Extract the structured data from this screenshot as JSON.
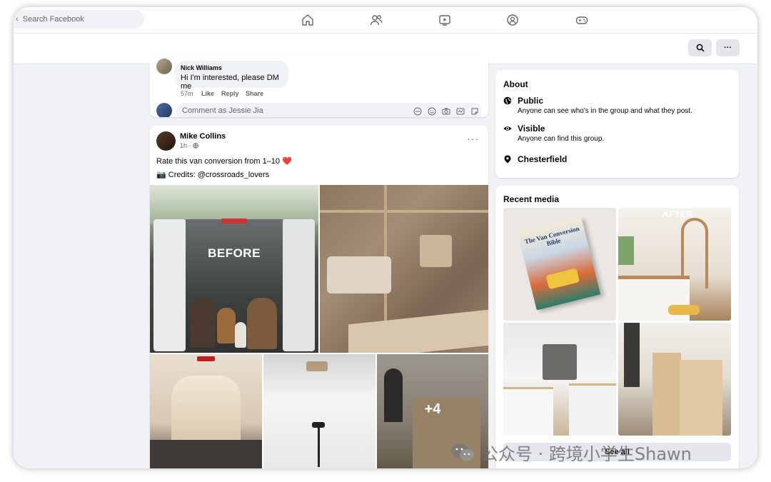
{
  "nav": {
    "search_placeholder": "Search Facebook",
    "icons": [
      "home-icon",
      "friends-icon",
      "watch-icon",
      "groups-icon",
      "gaming-icon"
    ]
  },
  "subbar": {
    "buttons": [
      "search-icon",
      "more-icon"
    ],
    "more_label": "···"
  },
  "comment": {
    "author": "Nick Williams",
    "text": "Hi I'm interested, please DM me",
    "time": "57m",
    "like": "Like",
    "reply": "Reply",
    "share": "Share",
    "input_placeholder": "Comment as Jessie Jia"
  },
  "post": {
    "author": "Mike Collins",
    "time": "1h ·",
    "text": "Rate this van conversion from 1–10 ❤️",
    "credits": "📷 Credits: @crossroads_lovers",
    "before_label": "BEFORE",
    "more_photos": "+4",
    "more_label": "···"
  },
  "about": {
    "title": "About",
    "rows": [
      {
        "icon": "globe-icon",
        "title": "Public",
        "desc": "Anyone can see who's in the group and what they post."
      },
      {
        "icon": "eye-icon",
        "title": "Visible",
        "desc": "Anyone can find this group."
      },
      {
        "icon": "location-pin-icon",
        "title": "Chesterfield",
        "desc": ""
      }
    ]
  },
  "recent_media": {
    "title": "Recent media",
    "book_title": "The Van Conversion Bible",
    "after_label": "AFTER",
    "see_all": "See all"
  },
  "watermark": {
    "text": "公众号 · 跨境小学生Shawn"
  },
  "colors": {
    "page_bg": "#f0f2f5",
    "card_bg": "#ffffff",
    "accent_blue": "#1877f2",
    "heart": "#e41e3f"
  }
}
